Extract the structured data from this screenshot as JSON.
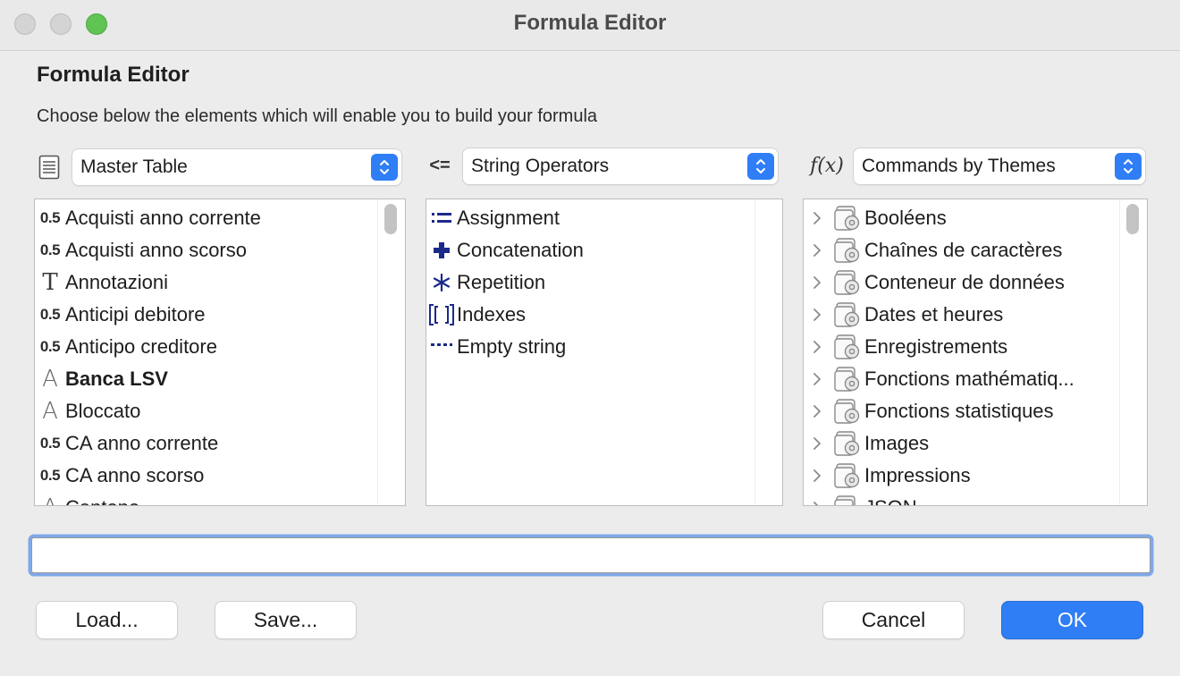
{
  "window": {
    "title": "Formula Editor"
  },
  "header": {
    "title": "Formula Editor",
    "subtitle": "Choose below the elements which will enable you to build your formula"
  },
  "columns": {
    "fields": {
      "icon": "table-icon",
      "selected": "Master Table",
      "items": [
        {
          "icon": "0.5",
          "label": "Acquisti anno corrente",
          "bold": false
        },
        {
          "icon": "0.5",
          "label": "Acquisti anno scorso",
          "bold": false
        },
        {
          "icon": "T",
          "label": "Annotazioni",
          "bold": false
        },
        {
          "icon": "0.5",
          "label": "Anticipi debitore",
          "bold": false
        },
        {
          "icon": "0.5",
          "label": "Anticipo creditore",
          "bold": false
        },
        {
          "icon": "A",
          "label": "Banca LSV",
          "bold": true
        },
        {
          "icon": "A",
          "label": "Bloccato",
          "bold": false
        },
        {
          "icon": "0.5",
          "label": "CA anno corrente",
          "bold": false
        },
        {
          "icon": "0.5",
          "label": "CA anno scorso",
          "bold": false
        },
        {
          "icon": "A",
          "label": "Cantone",
          "bold": false
        }
      ]
    },
    "operators": {
      "icon": "operator-icon",
      "icon_text": "<=",
      "selected": "String Operators",
      "items": [
        {
          "icon": "assignment-icon",
          "label": "Assignment"
        },
        {
          "icon": "plus-icon",
          "label": "Concatenation"
        },
        {
          "icon": "asterisk-icon",
          "label": "Repetition"
        },
        {
          "icon": "brackets-icon",
          "label": "Indexes"
        },
        {
          "icon": "empty-string-icon",
          "label": "Empty string"
        }
      ]
    },
    "commands": {
      "icon": "function-icon",
      "icon_text": "f(x)",
      "selected": "Commands by Themes",
      "items": [
        {
          "label": "Booléens"
        },
        {
          "label": "Chaînes de caractères"
        },
        {
          "label": "Conteneur de données"
        },
        {
          "label": "Dates et heures"
        },
        {
          "label": "Enregistrements"
        },
        {
          "label": "Fonctions mathématiq..."
        },
        {
          "label": "Fonctions statistiques"
        },
        {
          "label": "Images"
        },
        {
          "label": "Impressions"
        },
        {
          "label": "JSON"
        }
      ]
    }
  },
  "formula": {
    "value": ""
  },
  "buttons": {
    "load": "Load...",
    "save": "Save...",
    "cancel": "Cancel",
    "ok": "OK"
  },
  "colors": {
    "accent": "#2f7ef6",
    "operator": "#1b2a8a"
  }
}
